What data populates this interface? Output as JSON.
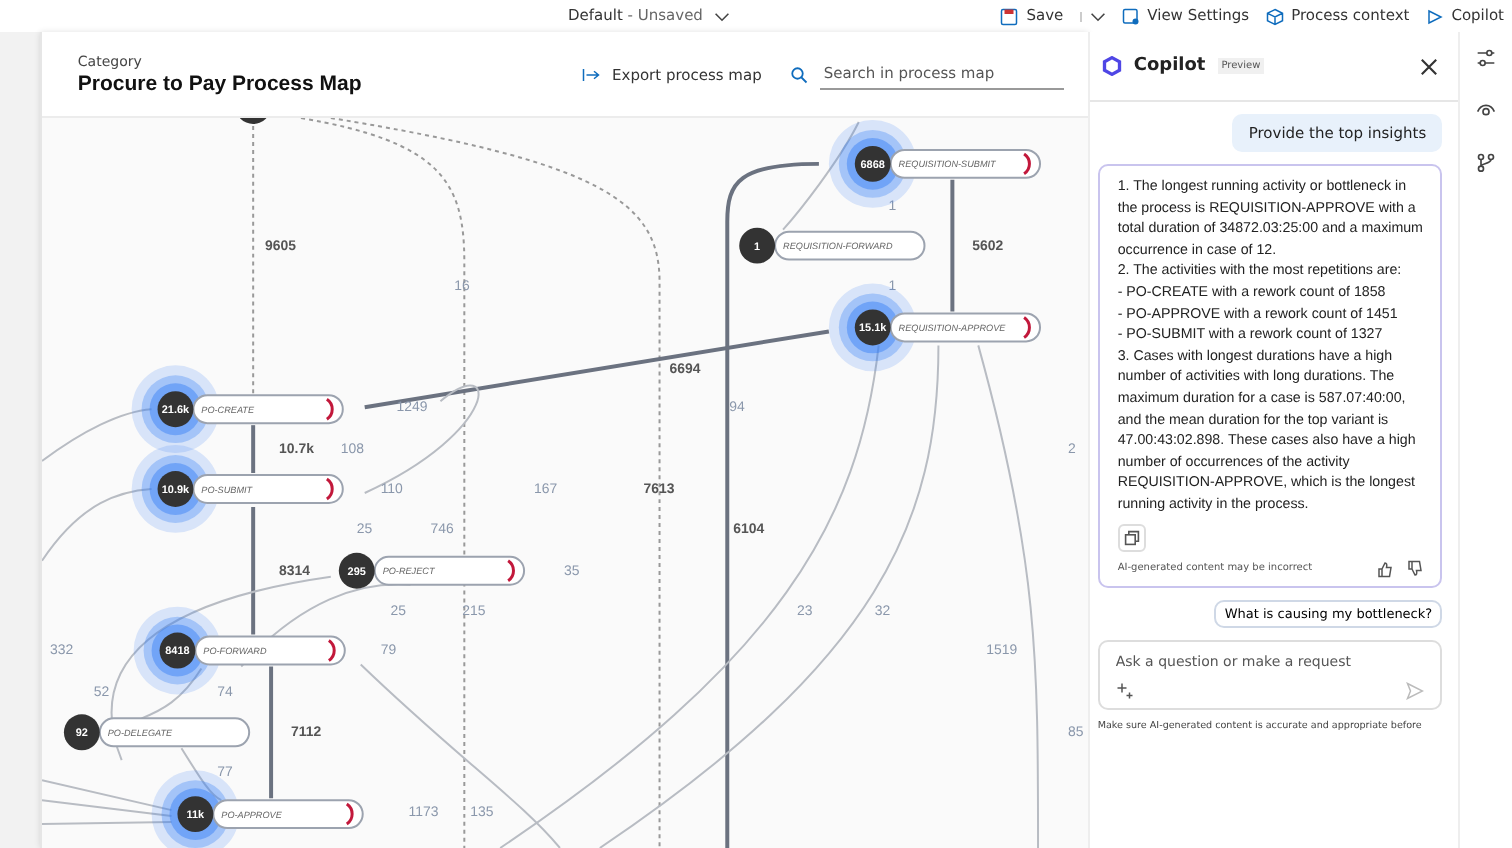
{
  "top_bar": {
    "view_name": "Default",
    "view_state": "- Unsaved",
    "buttons": [
      {
        "kind": "save",
        "label": "Save"
      },
      {
        "kind": "settings",
        "label": "View Settings"
      },
      {
        "kind": "context",
        "label": "Process context"
      },
      {
        "kind": "copilot",
        "label": "Copilot"
      }
    ]
  },
  "header": {
    "category": "Category",
    "title": "Procure to Pay Process Map",
    "export_label": "Export process map",
    "search": {
      "placeholder": "Search in process map"
    }
  },
  "process_map": {
    "nodes": [
      {
        "count": "6868",
        "label": "REQUISITION-SUBMIT",
        "highlighted": true
      },
      {
        "count": "1",
        "label": "REQUISITION-FORWARD",
        "highlighted": false
      },
      {
        "count": "15.1k",
        "label": "REQUISITION-APPROVE",
        "highlighted": true
      },
      {
        "count": "21.6k",
        "label": "PO-CREATE",
        "highlighted": true
      },
      {
        "count": "10.9k",
        "label": "PO-SUBMIT",
        "highlighted": true
      },
      {
        "count": "295",
        "label": "PO-REJECT",
        "highlighted": false
      },
      {
        "count": "8418",
        "label": "PO-FORWARD",
        "highlighted": true
      },
      {
        "count": "92",
        "label": "PO-DELEGATE",
        "highlighted": false
      },
      {
        "count": "11k",
        "label": "PO-APPROVE",
        "highlighted": true
      }
    ],
    "edge_labels": [
      {
        "text": "1",
        "kind": "minor"
      },
      {
        "text": "9605",
        "kind": "major"
      },
      {
        "text": "5602",
        "kind": "major"
      },
      {
        "text": "16",
        "kind": "minor"
      },
      {
        "text": "1",
        "kind": "minor"
      },
      {
        "text": "6694",
        "kind": "major"
      },
      {
        "text": "1249",
        "kind": "minor"
      },
      {
        "text": "94",
        "kind": "minor"
      },
      {
        "text": "10.7k",
        "kind": "major"
      },
      {
        "text": "108",
        "kind": "minor"
      },
      {
        "text": "2",
        "kind": "minor"
      },
      {
        "text": "110",
        "kind": "minor"
      },
      {
        "text": "167",
        "kind": "minor"
      },
      {
        "text": "7613",
        "kind": "major"
      },
      {
        "text": "25",
        "kind": "minor"
      },
      {
        "text": "746",
        "kind": "minor"
      },
      {
        "text": "6104",
        "kind": "major"
      },
      {
        "text": "8314",
        "kind": "major"
      },
      {
        "text": "35",
        "kind": "minor"
      },
      {
        "text": "25",
        "kind": "minor"
      },
      {
        "text": "215",
        "kind": "minor"
      },
      {
        "text": "23",
        "kind": "minor"
      },
      {
        "text": "32",
        "kind": "minor"
      },
      {
        "text": "332",
        "kind": "minor"
      },
      {
        "text": "79",
        "kind": "minor"
      },
      {
        "text": "1519",
        "kind": "minor"
      },
      {
        "text": "52",
        "kind": "minor"
      },
      {
        "text": "74",
        "kind": "minor"
      },
      {
        "text": "7112",
        "kind": "major"
      },
      {
        "text": "85",
        "kind": "minor"
      },
      {
        "text": "77",
        "kind": "minor"
      },
      {
        "text": "1173",
        "kind": "minor"
      },
      {
        "text": "135",
        "kind": "minor"
      }
    ]
  },
  "copilot": {
    "title": "Copilot",
    "badge": "Preview",
    "user_message": "Provide the top insights",
    "answer": "1. The longest running activity or bottleneck in the process is REQUISITION-APPROVE with a total duration of 34872.03:25:00 and a maximum occurrence in case of 12.\n2. The activities with the most repetitions are:\n- PO-CREATE with a rework count of 1858\n- PO-APPROVE with a rework count of 1451\n- PO-SUBMIT with a rework count of 1327\n3. Cases with longest durations have a high number of activities with long durations. The maximum duration for a case is 587.07:40:00, and the mean duration for the top variant is 47.00:43:02.898. These cases also have a high number of occurrences of the activity REQUISITION-APPROVE, which is the longest running activity in the process.",
    "disclaimer": "AI-generated content may be incorrect",
    "suggestion": "What is causing my bottleneck?",
    "input": {
      "placeholder": "Ask a question or make a request"
    },
    "footer": "Make sure AI-generated content is accurate and appropriate before"
  }
}
